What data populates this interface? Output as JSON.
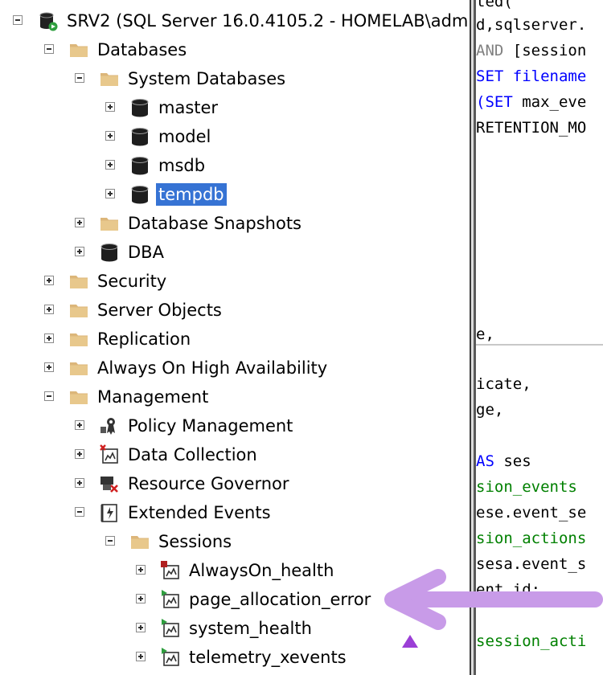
{
  "tree": [
    {
      "key": "server",
      "label": "SRV2 (SQL Server 16.0.4105.2 - HOMELAB\\admi",
      "icon": "server-icon",
      "expander": "minus"
    },
    {
      "key": "databases",
      "label": "Databases",
      "icon": "folder-icon",
      "expander": "minus"
    },
    {
      "key": "system-databases",
      "label": "System Databases",
      "icon": "folder-icon",
      "expander": "minus"
    },
    {
      "key": "master",
      "label": "master",
      "icon": "database-icon",
      "expander": "plus"
    },
    {
      "key": "model",
      "label": "model",
      "icon": "database-icon",
      "expander": "plus"
    },
    {
      "key": "msdb",
      "label": "msdb",
      "icon": "database-icon",
      "expander": "plus"
    },
    {
      "key": "tempdb",
      "label": "tempdb",
      "icon": "database-icon",
      "expander": "plus",
      "selected": true
    },
    {
      "key": "database-snapshots",
      "label": "Database Snapshots",
      "icon": "folder-icon",
      "expander": "plus"
    },
    {
      "key": "dba",
      "label": "DBA",
      "icon": "database-icon",
      "expander": "plus"
    },
    {
      "key": "security",
      "label": "Security",
      "icon": "folder-icon",
      "expander": "plus"
    },
    {
      "key": "server-objects",
      "label": "Server Objects",
      "icon": "folder-icon",
      "expander": "plus"
    },
    {
      "key": "replication",
      "label": "Replication",
      "icon": "folder-icon",
      "expander": "plus"
    },
    {
      "key": "always-on",
      "label": "Always On High Availability",
      "icon": "folder-icon",
      "expander": "plus"
    },
    {
      "key": "management",
      "label": "Management",
      "icon": "folder-icon",
      "expander": "minus"
    },
    {
      "key": "policy-management",
      "label": "Policy Management",
      "icon": "policy-icon",
      "expander": "plus"
    },
    {
      "key": "data-collection",
      "label": "Data Collection",
      "icon": "data-collection-icon",
      "expander": "plus"
    },
    {
      "key": "resource-governor",
      "label": "Resource Governor",
      "icon": "resource-governor-icon",
      "expander": "plus"
    },
    {
      "key": "extended-events",
      "label": "Extended Events",
      "icon": "extended-events-icon",
      "expander": "minus"
    },
    {
      "key": "sessions",
      "label": "Sessions",
      "icon": "folder-icon",
      "expander": "minus"
    },
    {
      "key": "alwayson-health",
      "label": "AlwaysOn_health",
      "icon": "session-stopped-icon",
      "expander": "plus"
    },
    {
      "key": "page-allocation-error",
      "label": "page_allocation_error",
      "icon": "session-running-icon",
      "expander": "plus"
    },
    {
      "key": "system-health",
      "label": "system_health",
      "icon": "session-running-icon",
      "expander": "plus"
    },
    {
      "key": "telemetry-xevents",
      "label": "telemetry_xevents",
      "icon": "session-running-icon",
      "expander": "plus"
    }
  ],
  "editor_lines": [
    {
      "text": "ted(",
      "color": "#000000"
    },
    {
      "text": "d,sqlserver.",
      "color": "#000000"
    },
    {
      "text": "AND [session",
      "color": "#000000",
      "prefix": "AND",
      "prefix_color": "#808080"
    },
    {
      "text": "SET filename",
      "color": "#0000ff"
    },
    {
      "text": "(SET max_eve",
      "color": "#000000",
      "prefix": "(SET",
      "prefix_color": "#0000ff"
    },
    {
      "text": "RETENTION_MO",
      "color": "#000000"
    },
    {
      "text": "e,",
      "color": "#000000"
    },
    {
      "text": "icate,",
      "color": "#000000"
    },
    {
      "text": "ge,",
      "color": "#000000"
    },
    {
      "text": "AS ses",
      "color": "#000000",
      "prefix": "AS",
      "prefix_color": "#0000ff"
    },
    {
      "text": "sion_events",
      "color": "#008000"
    },
    {
      "text": "ese.event_se",
      "color": "#000000"
    },
    {
      "text": "sion_actions",
      "color": "#008000"
    },
    {
      "text": "sesa.event_s",
      "color": "#000000"
    },
    {
      "text": "ent_id;",
      "color": "#000000"
    },
    {
      "text": "session_acti",
      "color": "#008000"
    }
  ],
  "colors": {
    "selection": "#3673d4",
    "folder": "#dcb67a",
    "annotation": "#c89be8"
  }
}
